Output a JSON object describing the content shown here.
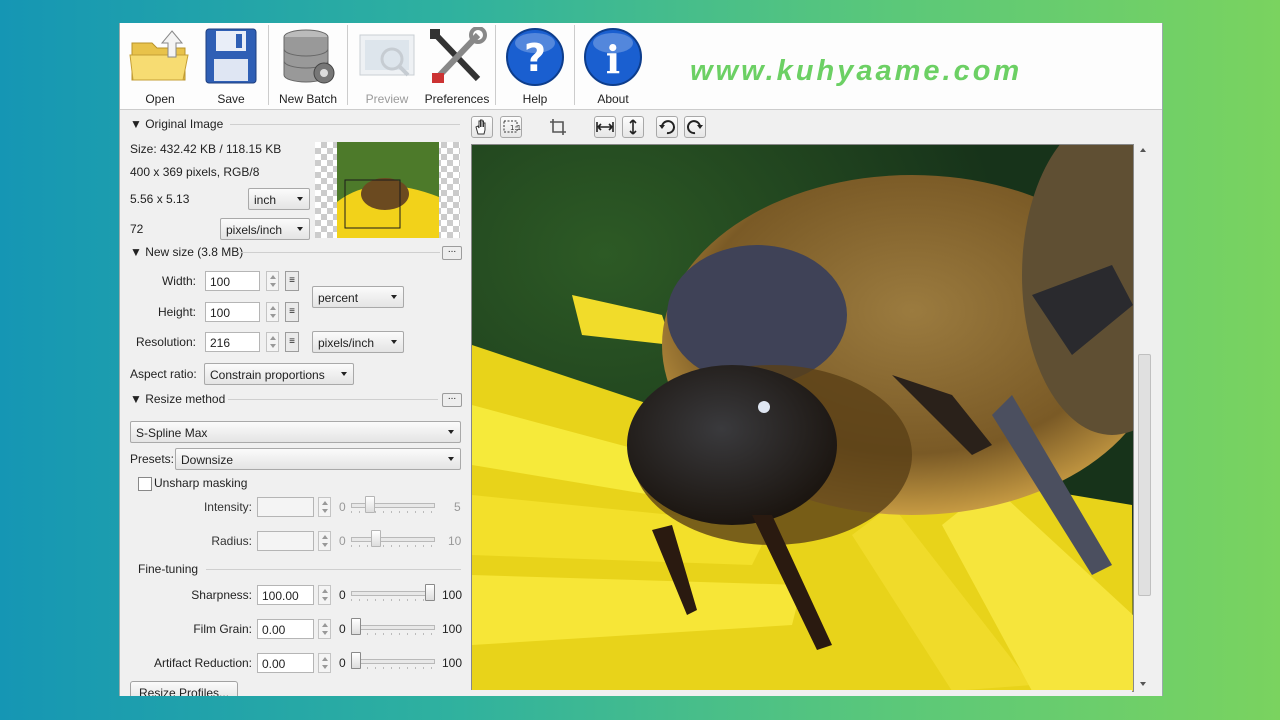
{
  "toolbar": {
    "open": "Open",
    "save": "Save",
    "new_batch": "New Batch",
    "preview": "Preview",
    "preferences": "Preferences",
    "help": "Help",
    "about": "About"
  },
  "watermark": "www.kuhyaame.com",
  "original_image": {
    "header": "▼ Original Image",
    "size": "Size: 432.42 KB / 118.15 KB",
    "pixels": "400 x 369 pixels, RGB/8",
    "dimensions": "5.56 x 5.13",
    "dim_unit": "inch",
    "resolution": "72",
    "res_unit": "pixels/inch"
  },
  "new_size": {
    "header": "▼ New size (3.8 MB)",
    "width_label": "Width:",
    "width_value": "100",
    "height_label": "Height:",
    "height_value": "100",
    "resolution_label": "Resolution:",
    "resolution_value": "216",
    "size_unit": "percent",
    "res_unit": "pixels/inch",
    "aspect_label": "Aspect ratio:",
    "aspect_value": "Constrain proportions"
  },
  "resize_method": {
    "header": "▼ Resize method",
    "method": "S-Spline Max",
    "presets_label": "Presets:",
    "presets_value": "Downsize",
    "unsharp_label": "Unsharp masking",
    "intensity_label": "Intensity:",
    "intensity_min": "0",
    "intensity_max": "5",
    "radius_label": "Radius:",
    "radius_min": "0",
    "radius_max": "10"
  },
  "fine_tuning": {
    "header": "Fine-tuning",
    "sharpness_label": "Sharpness:",
    "sharpness_value": "100.00",
    "film_grain_label": "Film Grain:",
    "film_grain_value": "0.00",
    "artifact_label": "Artifact Reduction:",
    "artifact_value": "0.00",
    "min": "0",
    "max": "100",
    "sharpness_level": 1.0,
    "film_grain_level": 0.0,
    "artifact_level": 0.0
  },
  "resize_profiles_button": "Resize Profiles...",
  "colors": {
    "watermark": "#6cd064",
    "help_blue": "#1a5fd0"
  }
}
